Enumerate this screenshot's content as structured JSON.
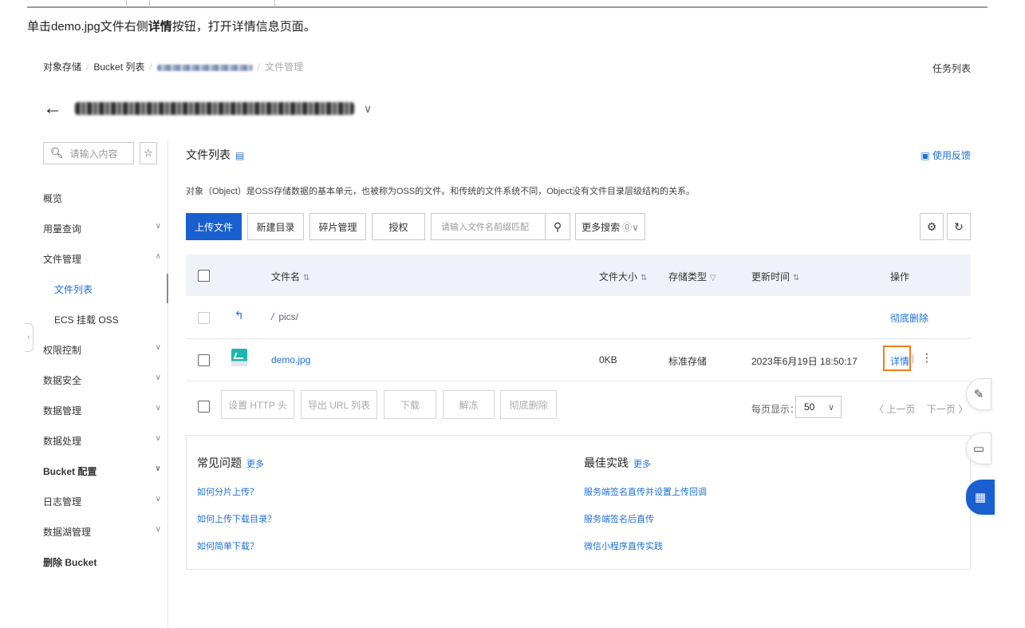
{
  "instruction": {
    "prefix": "单击demo.jpg文件右侧",
    "bold": "详情",
    "suffix": "按钮，打开详情信息页面。"
  },
  "breadcrumb": {
    "item1": "对象存储",
    "item2": "Bucket 列表",
    "item4": "文件管理"
  },
  "header": {
    "task_list": "任务列表"
  },
  "sidebar": {
    "search_placeholder": "请输入内容",
    "items": [
      {
        "label": "概览"
      },
      {
        "label": "用量查询"
      },
      {
        "label": "文件管理"
      },
      {
        "label": "文件列表"
      },
      {
        "label": "ECS 挂载 OSS"
      },
      {
        "label": "权限控制"
      },
      {
        "label": "数据安全"
      },
      {
        "label": "数据管理"
      },
      {
        "label": "数据处理"
      },
      {
        "label": "Bucket 配置"
      },
      {
        "label": "日志管理"
      },
      {
        "label": "数据湖管理"
      },
      {
        "label": "删除 Bucket"
      }
    ]
  },
  "main": {
    "title": "文件列表",
    "feedback": "使用反馈",
    "description": "对象（Object）是OSS存储数据的基本单元，也被称为OSS的文件。和传统的文件系统不同，Object没有文件目录层级结构的关系。",
    "toolbar": {
      "upload": "上传文件",
      "new_dir": "新建目录",
      "fragments": "碎片管理",
      "authorize": "授权",
      "search_placeholder": "请输入文件名前缀匹配",
      "more_search": "更多搜索"
    },
    "table": {
      "headers": {
        "name": "文件名",
        "size": "文件大小",
        "storage": "存储类型",
        "updated": "更新时间",
        "actions": "操作"
      },
      "folder_row": {
        "name": "pics/",
        "action": "彻底删除"
      },
      "file_row": {
        "name": "demo.jpg",
        "size": "0KB",
        "storage": "标准存储",
        "updated": "2023年6月19日 18:50:17",
        "detail": "详情"
      }
    },
    "footer": {
      "set_http": "设置 HTTP 头",
      "export_url": "导出 URL 列表",
      "download": "下载",
      "unfreeze": "解冻",
      "delete": "彻底删除",
      "per_page_label": "每页显示：",
      "per_page": "50",
      "prev": "上一页",
      "next": "下一页"
    },
    "faq": {
      "title": "常见问题",
      "more": "更多",
      "links": [
        "如何分片上传？",
        "如何上传下载目录？",
        "如何简单下载？"
      ]
    },
    "best": {
      "title": "最佳实践",
      "more": "更多",
      "links": [
        "服务端签名直传并设置上传回调",
        "服务端签名后直传",
        "微信小程序直传实践"
      ]
    }
  },
  "colors": {
    "primary": "#1a5fd0",
    "link": "#1f6fd8",
    "highlight": "#f27b1b"
  }
}
